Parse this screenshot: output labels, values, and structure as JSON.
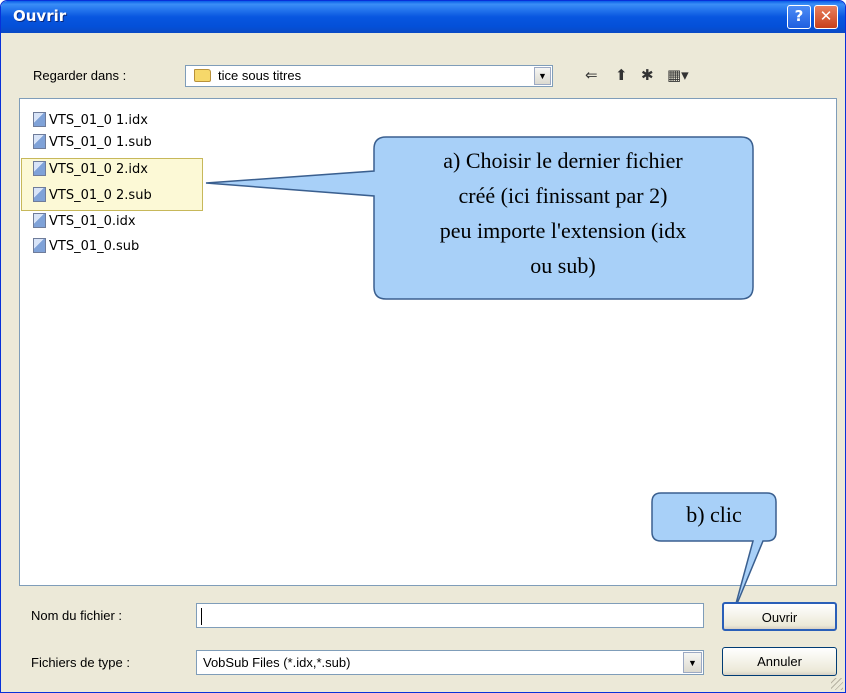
{
  "window": {
    "title": "Ouvrir",
    "help_label": "?",
    "close_label": "✕"
  },
  "location": {
    "label": "Regarder dans :",
    "value": "tice sous titres",
    "arrow": "▼"
  },
  "toolbar": {
    "back": "⇐",
    "up": "⬆",
    "new_folder": "✱",
    "view": "▦▾"
  },
  "files": [
    {
      "name": "VTS_01_0 1.idx"
    },
    {
      "name": "VTS_01_0 1.sub"
    },
    {
      "name": "VTS_01_0 2.idx"
    },
    {
      "name": "VTS_01_0 2.sub"
    },
    {
      "name": "VTS_01_0.idx"
    },
    {
      "name": "VTS_01_0.sub"
    }
  ],
  "callouts": {
    "a_line1": "a) Choisir le dernier fichier",
    "a_line2": "créé (ici finissant par 2)",
    "a_line3": "peu importe l'extension (idx",
    "a_line4": "ou sub)",
    "b": "b) clic"
  },
  "filename": {
    "label": "Nom du fichier :",
    "value": ""
  },
  "filetype": {
    "label": "Fichiers de type :",
    "value": "VobSub Files (*.idx,*.sub)",
    "arrow": "▼"
  },
  "buttons": {
    "open": "Ouvrir",
    "cancel": "Annuler"
  },
  "colors": {
    "titlebar": "#0a5fe8",
    "callout_fill": "#a8d0f8",
    "highlight": "#faf4b4"
  }
}
